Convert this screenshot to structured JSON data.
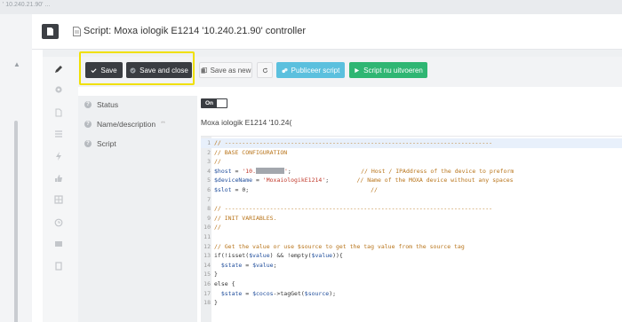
{
  "breadcrumb": "' 10.240.21.90' ...",
  "header": {
    "title": "Script: Moxa iologik E1214 '10.240.21.90' controller",
    "doc_icon": "document-icon"
  },
  "toolbar": {
    "save_label": "Save",
    "save_close_label": "Save and close",
    "save_as_new_label": "Save as new",
    "publish_label": "Publiceer script",
    "run_label": "Script nu uitvoeren",
    "colors": {
      "dark": "#3a3d42",
      "teal": "#5bc0de",
      "green": "#2fb673",
      "highlight": "#f0e000"
    }
  },
  "form": {
    "status_label": "Status",
    "status_value": "On",
    "name_label": "Name/description",
    "name_required_mark": "**",
    "name_value": "Moxa iologik E1214 '10.24(",
    "script_label": "Script"
  },
  "sidebar_icons": [
    "pencil-icon",
    "gear-icon",
    "document-icon",
    "list-icon",
    "bolt-icon",
    "thumbs-up-icon",
    "grid-icon",
    "history-icon",
    "image-icon",
    "tablet-icon"
  ],
  "code_lines": [
    {
      "n": "1",
      "parts": [
        [
          "c-com",
          "// -----------------------------------------------------------------------------"
        ]
      ]
    },
    {
      "n": "2",
      "parts": [
        [
          "c-com",
          "// BASE CONFIGURATION"
        ]
      ]
    },
    {
      "n": "3",
      "parts": [
        [
          "c-com",
          "//"
        ]
      ]
    },
    {
      "n": "4",
      "parts": [
        [
          "c-var",
          "$host"
        ],
        [
          "c-kw",
          " = "
        ],
        [
          "c-str",
          "'10."
        ],
        [
          "redact",
          ""
        ],
        [
          "c-str",
          "'"
        ],
        [
          "c-kw",
          ";                    "
        ],
        [
          "c-com",
          "// Host / IPAddress of the device to preform"
        ]
      ]
    },
    {
      "n": "5",
      "parts": [
        [
          "c-var",
          "$deviceName"
        ],
        [
          "c-kw",
          " = "
        ],
        [
          "c-str",
          "'MoxaiologikE1214'"
        ],
        [
          "c-kw",
          ";        "
        ],
        [
          "c-com",
          "// Name of the MOXA device without any spaces"
        ]
      ]
    },
    {
      "n": "6",
      "parts": [
        [
          "c-var",
          "$slot"
        ],
        [
          "c-kw",
          " = 0;                                   "
        ],
        [
          "c-com",
          "//"
        ]
      ]
    },
    {
      "n": "7",
      "parts": [
        [
          "c-kw",
          ""
        ]
      ]
    },
    {
      "n": "8",
      "parts": [
        [
          "c-com",
          "// -----------------------------------------------------------------------------"
        ]
      ]
    },
    {
      "n": "9",
      "parts": [
        [
          "c-com",
          "// INIT VARIABLES."
        ]
      ]
    },
    {
      "n": "10",
      "parts": [
        [
          "c-com",
          "//"
        ]
      ]
    },
    {
      "n": "11",
      "parts": [
        [
          "c-kw",
          ""
        ]
      ]
    },
    {
      "n": "12",
      "parts": [
        [
          "c-com",
          "// Get the value or use $source to get the tag value from the source tag"
        ]
      ]
    },
    {
      "n": "13",
      "parts": [
        [
          "c-kw",
          "if(!isset("
        ],
        [
          "c-var",
          "$value"
        ],
        [
          "c-kw",
          ") && !empty("
        ],
        [
          "c-var",
          "$value"
        ],
        [
          "c-kw",
          ")){"
        ]
      ]
    },
    {
      "n": "14",
      "parts": [
        [
          "c-kw",
          "  "
        ],
        [
          "c-var",
          "$state"
        ],
        [
          "c-kw",
          " = "
        ],
        [
          "c-var",
          "$value"
        ],
        [
          "c-kw",
          ";"
        ]
      ]
    },
    {
      "n": "15",
      "parts": [
        [
          "c-kw",
          "}"
        ]
      ]
    },
    {
      "n": "16",
      "parts": [
        [
          "c-kw",
          "else {"
        ]
      ]
    },
    {
      "n": "17",
      "parts": [
        [
          "c-kw",
          "  "
        ],
        [
          "c-var",
          "$state"
        ],
        [
          "c-kw",
          " = "
        ],
        [
          "c-var",
          "$cocos"
        ],
        [
          "c-kw",
          "->tagGet("
        ],
        [
          "c-var",
          "$source"
        ],
        [
          "c-kw",
          ");"
        ]
      ]
    },
    {
      "n": "18",
      "parts": [
        [
          "c-kw",
          "}"
        ]
      ]
    }
  ]
}
